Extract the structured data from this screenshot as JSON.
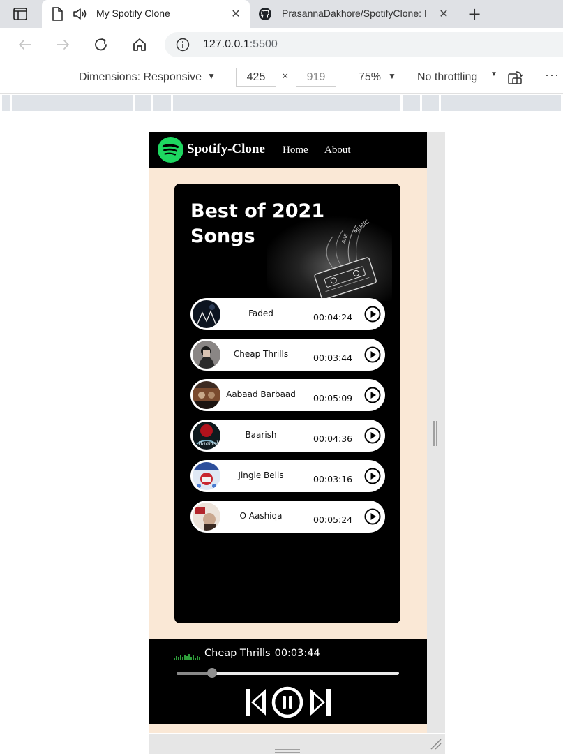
{
  "browser": {
    "tabs": [
      {
        "title": "My Spotify Clone",
        "icon": "document-icon",
        "audio_icon": "speaker-icon",
        "active": true
      },
      {
        "title": "PrasannaDakhore/SpotifyClone: I",
        "icon": "github-icon",
        "active": false
      }
    ],
    "url_host": "127.0.0.1",
    "url_port": ":5500"
  },
  "devtools": {
    "dimensions_label": "Dimensions: Responsive",
    "width": "425",
    "height": "919",
    "times": "×",
    "zoom": "75%",
    "throttling": "No throttling"
  },
  "app": {
    "brand": "Spotify-Clone",
    "nav": {
      "home": "Home",
      "about": "About"
    },
    "playlist_title": "Best of 2021 Songs",
    "songs": [
      {
        "name": "Faded",
        "duration": "00:04:24"
      },
      {
        "name": "Cheap Thrills",
        "duration": "00:03:44"
      },
      {
        "name": "Aabaad Barbaad",
        "duration": "00:05:09"
      },
      {
        "name": "Baarish",
        "duration": "00:04:36"
      },
      {
        "name": "Jingle Bells",
        "duration": "00:03:16"
      },
      {
        "name": "O Aashiqa",
        "duration": "00:05:24"
      }
    ],
    "player": {
      "current_song": "Cheap Thrills",
      "current_duration": "00:03:44",
      "progress_fraction": 0.16
    }
  },
  "colors": {
    "background": "#fae8d6",
    "navbar": "#000000",
    "spotify_green": "#1ed760",
    "container": "#000000"
  }
}
